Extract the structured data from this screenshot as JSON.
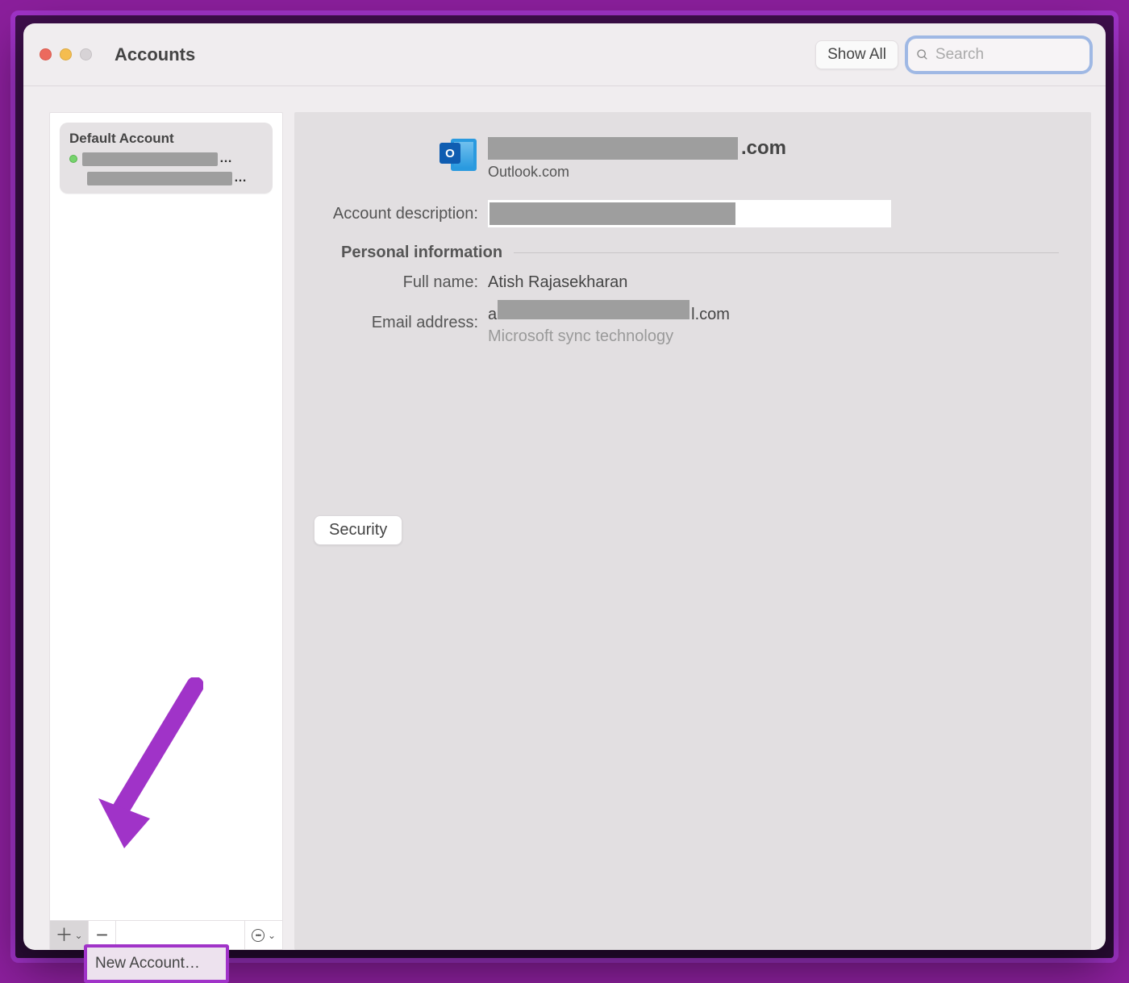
{
  "window": {
    "title": "Accounts"
  },
  "toolbar": {
    "show_all_label": "Show All",
    "search_placeholder": "Search"
  },
  "sidebar": {
    "default_label": "Default Account",
    "add_tooltip": "+",
    "remove_tooltip": "−",
    "new_account_menu": "New Account…"
  },
  "detail": {
    "email_suffix": ".com",
    "provider": "Outlook.com",
    "desc_label": "Account description:",
    "section_personal": "Personal information",
    "fullname_label": "Full name:",
    "fullname_value": "Atish Rajasekharan",
    "email_label": "Email address:",
    "email_prefix_char": "a",
    "email_suffix2": "l.com",
    "sync_note": "Microsoft sync technology",
    "security_btn": "Security"
  }
}
